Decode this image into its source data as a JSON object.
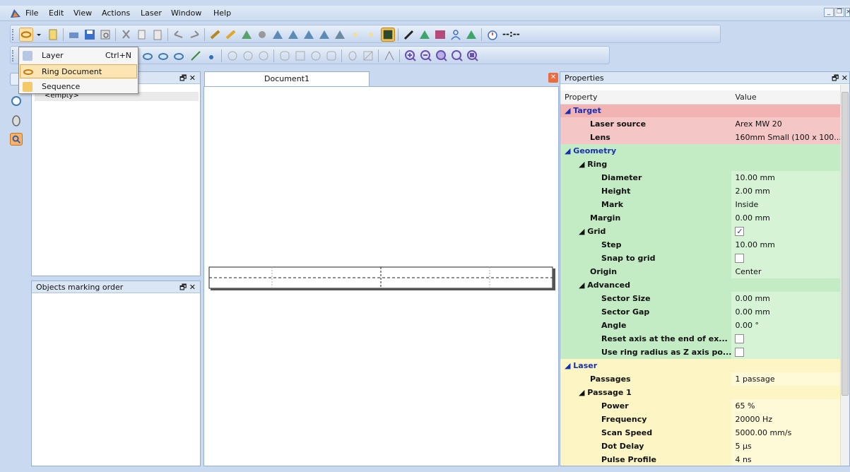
{
  "menu": {
    "file": "File",
    "edit": "Edit",
    "view": "View",
    "actions": "Actions",
    "laser": "Laser",
    "window": "Window",
    "help": "Help"
  },
  "toolbar": {
    "timer_text": "--:--"
  },
  "dropdown": {
    "items": [
      {
        "label": "Layer",
        "shortcut": "Ctrl+N"
      },
      {
        "label": "Ring Document",
        "shortcut": ""
      },
      {
        "label": "Sequence",
        "shortcut": ""
      }
    ]
  },
  "layers_panel": {
    "empty_text": "<empty>"
  },
  "order_panel": {
    "title": "Objects marking order"
  },
  "document": {
    "tab": "Document1"
  },
  "properties": {
    "title": "Properties",
    "col_property": "Property",
    "col_value": "Value",
    "target": {
      "label": "Target",
      "laser_source": "Laser source",
      "laser_source_val": "Arex MW 20",
      "lens": "Lens",
      "lens_val": "160mm Small (100 x 100..."
    },
    "geometry": {
      "label": "Geometry",
      "ring": "Ring",
      "diameter": "Diameter",
      "diameter_val": "10.00 mm",
      "height": "Height",
      "height_val": "2.00 mm",
      "mark": "Mark",
      "mark_val": "Inside",
      "margin": "Margin",
      "margin_val": "0.00 mm",
      "grid": "Grid",
      "grid_checked": true,
      "step": "Step",
      "step_val": "10.00 mm",
      "snap": "Snap to grid",
      "snap_checked": false,
      "origin": "Origin",
      "origin_val": "Center",
      "advanced": "Advanced",
      "sector_size": "Sector Size",
      "sector_size_val": "0.00 mm",
      "sector_gap": "Sector Gap",
      "sector_gap_val": "0.00 mm",
      "angle": "Angle",
      "angle_val": "0.00 °",
      "reset_axis": "Reset axis at the end of ex...",
      "reset_axis_checked": false,
      "use_ring": "Use ring radius as Z axis po...",
      "use_ring_checked": false
    },
    "laser": {
      "label": "Laser",
      "passages": "Passages",
      "passages_val": "1 passage",
      "passage1": "Passage 1",
      "power": "Power",
      "power_val": "65 %",
      "frequency": "Frequency",
      "frequency_val": "20000 Hz",
      "scan_speed": "Scan Speed",
      "scan_speed_val": "5000.00 mm/s",
      "dot_delay": "Dot Delay",
      "dot_delay_val": "5 µs",
      "pulse_profile": "Pulse Profile",
      "pulse_profile_val": "4 ns"
    }
  },
  "colors": {
    "accent": "#c9daf0",
    "target": "#f4c6c6",
    "geometry": "#c4ecc4",
    "laser": "#fdf6c4",
    "section_text": "#1a2fb0"
  }
}
